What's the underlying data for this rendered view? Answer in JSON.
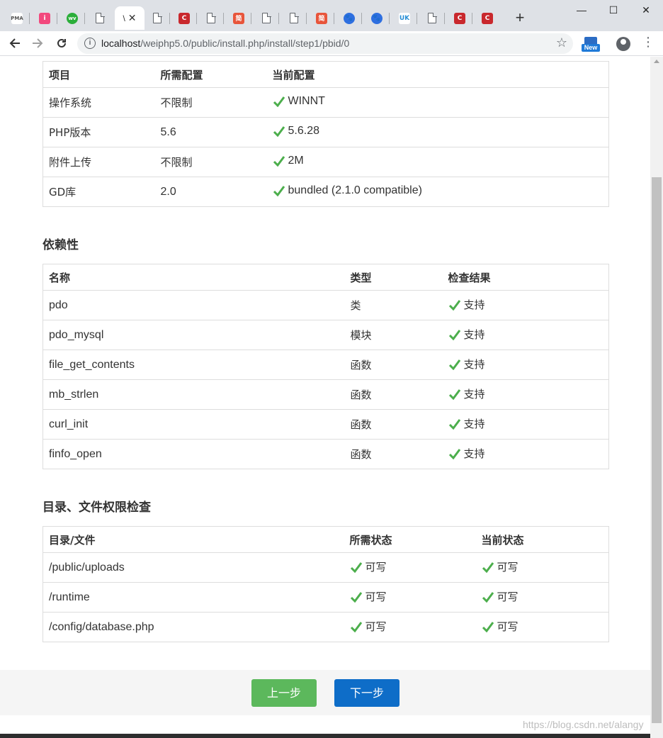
{
  "browser": {
    "tabs": [
      {
        "icon": "pma-icon",
        "label": "PMA"
      },
      {
        "icon": "pink-i-icon",
        "label": "i"
      },
      {
        "icon": "green-wv-icon",
        "label": "wv"
      },
      {
        "icon": "page-icon",
        "label": ""
      },
      {
        "icon": "active-tab",
        "label": "\\"
      },
      {
        "icon": "page-icon",
        "label": ""
      },
      {
        "icon": "csdn-c-icon",
        "label": "C"
      },
      {
        "icon": "page-icon",
        "label": ""
      },
      {
        "icon": "jian-icon",
        "label": "简"
      },
      {
        "icon": "page-icon",
        "label": ""
      },
      {
        "icon": "page-icon",
        "label": ""
      },
      {
        "icon": "jian-icon",
        "label": "简"
      },
      {
        "icon": "baidu-paw-icon",
        "label": ""
      },
      {
        "icon": "baidu-paw-icon",
        "label": ""
      },
      {
        "icon": "uk-icon",
        "label": "UK"
      },
      {
        "icon": "page-icon",
        "label": ""
      },
      {
        "icon": "csdn-c-icon",
        "label": "C"
      },
      {
        "icon": "csdn-c-icon",
        "label": "C"
      }
    ],
    "active_tab_title": "\\",
    "url_host": "localhost",
    "url_path": "/weiphp5.0/public/install.php/install/step1/pbid/0",
    "ext_badge": "New"
  },
  "env": {
    "headers": [
      "项目",
      "所需配置",
      "当前配置"
    ],
    "rows": [
      [
        "操作系统",
        "不限制",
        "WINNT"
      ],
      [
        "PHP版本",
        "5.6",
        "5.6.28"
      ],
      [
        "附件上传",
        "不限制",
        "2M"
      ],
      [
        "GD库",
        "2.0",
        "bundled (2.1.0 compatible)"
      ]
    ]
  },
  "deps": {
    "title": "依赖性",
    "headers": [
      "名称",
      "类型",
      "检查结果"
    ],
    "rows": [
      [
        "pdo",
        "类",
        "支持"
      ],
      [
        "pdo_mysql",
        "模块",
        "支持"
      ],
      [
        "file_get_contents",
        "函数",
        "支持"
      ],
      [
        "mb_strlen",
        "函数",
        "支持"
      ],
      [
        "curl_init",
        "函数",
        "支持"
      ],
      [
        "finfo_open",
        "函数",
        "支持"
      ]
    ]
  },
  "perms": {
    "title": "目录、文件权限检查",
    "headers": [
      "目录/文件",
      "所需状态",
      "当前状态"
    ],
    "rows": [
      [
        "/public/uploads",
        "可写",
        "可写"
      ],
      [
        "/runtime",
        "可写",
        "可写"
      ],
      [
        "/config/database.php",
        "可写",
        "可写"
      ]
    ]
  },
  "footer": {
    "prev_label": "上一步",
    "next_label": "下一步"
  },
  "watermark": "https://blog.csdn.net/alangy",
  "colors": {
    "check": "#4cae4c",
    "prev_button": "#5cb85c",
    "next_button": "#0e6dc8"
  }
}
